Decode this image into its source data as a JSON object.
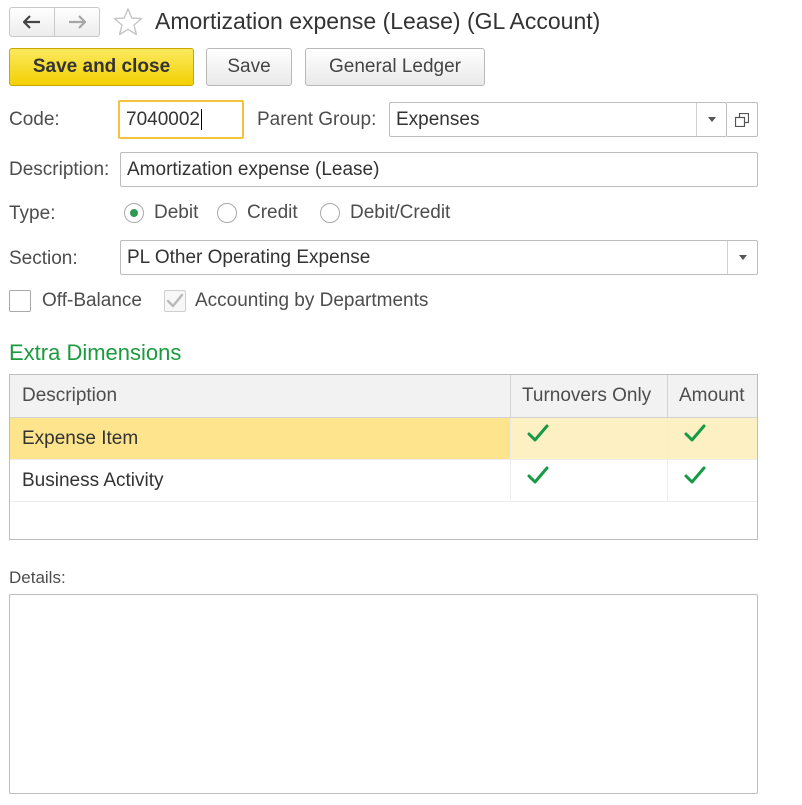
{
  "header": {
    "title": "Amortization expense (Lease) (GL Account)",
    "back_icon": "arrow-left-icon",
    "forward_icon": "arrow-right-icon",
    "favorite_icon": "star-icon"
  },
  "toolbar": {
    "save_and_close": "Save and close",
    "save": "Save",
    "general_ledger": "General Ledger"
  },
  "form": {
    "code_label": "Code:",
    "code_value": "7040002",
    "parent_group_label": "Parent Group:",
    "parent_group_value": "Expenses",
    "description_label": "Description:",
    "description_value": "Amortization expense (Lease)",
    "type_label": "Type:",
    "type_options": [
      "Debit",
      "Credit",
      "Debit/Credit"
    ],
    "type_selected": "Debit",
    "section_label": "Section:",
    "section_value": "PL Other Operating Expense",
    "off_balance_label": "Off-Balance",
    "off_balance_checked": false,
    "accounting_by_departments_label": "Accounting by Departments",
    "accounting_by_departments_checked": true
  },
  "extra_dimensions": {
    "title": "Extra Dimensions",
    "columns": [
      "Description",
      "Turnovers Only",
      "Amount"
    ],
    "rows": [
      {
        "description": "Expense Item",
        "turnovers_only": true,
        "amount": true,
        "selected": true
      },
      {
        "description": "Business Activity",
        "turnovers_only": true,
        "amount": true,
        "selected": false
      }
    ]
  },
  "details": {
    "label": "Details:",
    "value": ""
  },
  "colors": {
    "primary_button": "#f5d416",
    "accent_green": "#1b9a3e",
    "focus_border": "#f3c33d",
    "selected_row": "#fde48d"
  }
}
